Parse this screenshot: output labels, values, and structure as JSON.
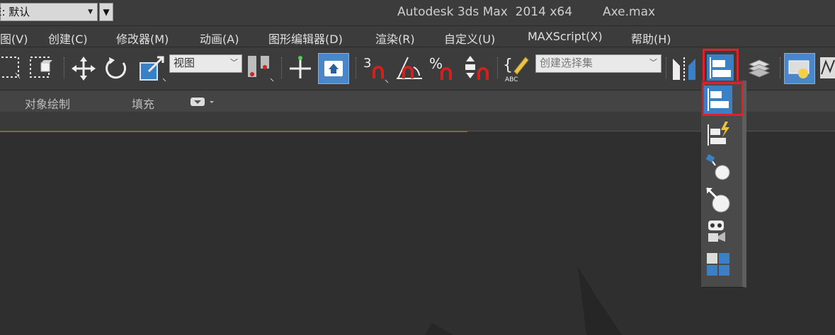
{
  "titlebar": {
    "workspace_label": "E: 默认",
    "app_title": "Autodesk 3ds Max  2014 x64",
    "file_name": "Axe.max"
  },
  "menu": {
    "items": [
      "图(V)",
      "创建(C)",
      "修改器(M)",
      "动画(A)",
      "图形编辑器(D)",
      "渲染(R)",
      "自定义(U)",
      "MAXScript(X)",
      "帮助(H)"
    ]
  },
  "toolbar": {
    "reference_coord_value": "视图",
    "named_selection_placeholder": "创建选择集",
    "snap_angle_label": "3",
    "percent_snap_label": "%",
    "edit_named_sets_label": "ABC",
    "highlighted_button": "align-button"
  },
  "ribbon": {
    "tabs": [
      "对象绘制",
      "填充"
    ]
  },
  "flyout": {
    "items": [
      "align-icon",
      "quick-align-icon",
      "normal-align-icon",
      "place-highlight-icon",
      "align-camera-icon",
      "align-to-view-icon"
    ],
    "highlighted_item": "align-icon"
  },
  "colors": {
    "accent_active": "#4b86c8",
    "highlight_border": "#e0202a",
    "snap_magnet": "#d02020"
  }
}
